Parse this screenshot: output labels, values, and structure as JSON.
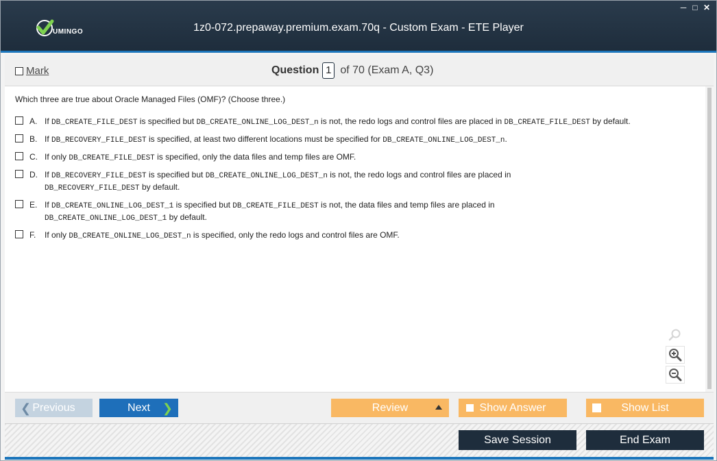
{
  "window": {
    "title": "1z0-072.prepaway.premium.exam.70q - Custom Exam - ETE Player",
    "logo_text": "UMINGO",
    "controls": [
      "minimize-icon",
      "maximize-icon",
      "close-icon"
    ],
    "brand_color": "#1e2d3c",
    "accent_color": "#1b75bb"
  },
  "header": {
    "mark_label": "Mark",
    "question_label": "Question",
    "question_number": "1",
    "question_total_text": "of 70 (Exam A, Q3)"
  },
  "question": {
    "text": "Which three are true about Oracle Managed Files (OMF)? (Choose three.)",
    "options": [
      {
        "letter": "A.",
        "parts": [
          "If ",
          "DB_CREATE_FILE_DEST",
          " is specified but ",
          "DB_CREATE_ONLINE_LOG_DEST_n",
          " is not, the redo logs and control files are placed in ",
          "DB_CREATE_FILE_DEST",
          " by default."
        ]
      },
      {
        "letter": "B.",
        "parts": [
          "If ",
          "DB_RECOVERY_FILE_DEST",
          " is specified, at least two different locations must be specified for ",
          "DB_CREATE_ONLINE_LOG_DEST_n",
          "."
        ]
      },
      {
        "letter": "C.",
        "parts": [
          "If only ",
          "DB_CREATE_FILE_DEST",
          " is specified, only the data files and temp files are OMF."
        ]
      },
      {
        "letter": "D.",
        "parts": [
          "If ",
          "DB_RECOVERY_FILE_DEST",
          "  is specified but ",
          "DB_CREATE_ONLINE_LOG_DEST_n",
          " is not, the redo logs and control files are placed in ",
          "DB_RECOVERY_FILE_DEST",
          "  by default."
        ]
      },
      {
        "letter": "E.",
        "parts": [
          "If ",
          "DB_CREATE_ONLINE_LOG_DEST_1",
          " is specified but ",
          "DB_CREATE_FILE_DEST",
          "  is not, the data files and temp files are placed in ",
          "DB_CREATE_ONLINE_LOG_DEST_1",
          "  by default."
        ]
      },
      {
        "letter": "F.",
        "parts": [
          "If only ",
          "DB_CREATE_ONLINE_LOG_DEST_n",
          "  is specified, only the redo logs and control files are OMF."
        ]
      }
    ]
  },
  "zoom": {
    "icons": [
      "search-icon",
      "zoom-in-icon",
      "zoom-out-icon"
    ]
  },
  "nav": {
    "previous_label": "Previous",
    "next_label": "Next",
    "review_label": "Review",
    "show_answer_label": "Show Answer",
    "show_list_label": "Show List",
    "button_orange": "#f9b863",
    "button_blue": "#1e6fba"
  },
  "footer": {
    "save_label": "Save Session",
    "end_label": "End Exam"
  }
}
